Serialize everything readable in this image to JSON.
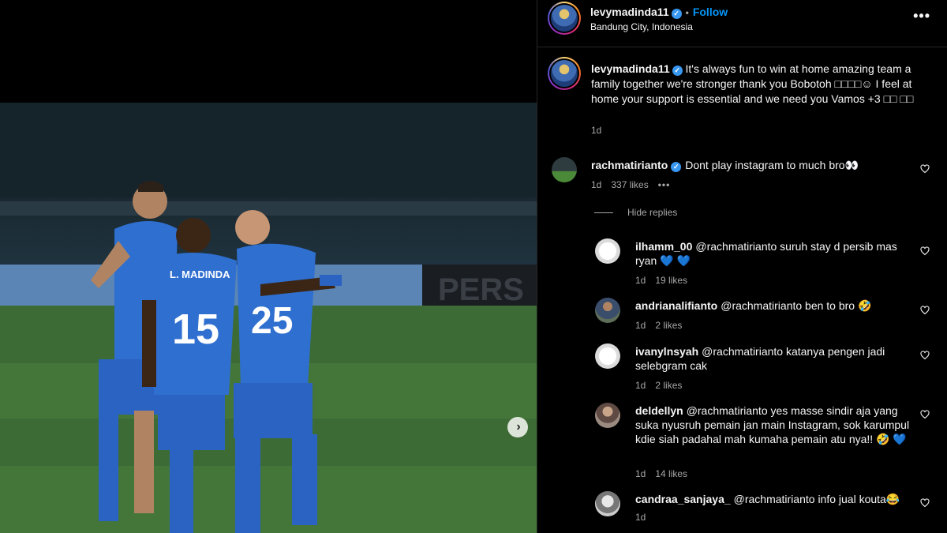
{
  "post": {
    "username": "levymadinda11",
    "verified_mark": "✓",
    "follow_label": "Follow",
    "separator": "•",
    "location": "Bandung City, Indonesia",
    "more_icon": "more-horizontal-icon",
    "more_glyph": "•••"
  },
  "caption": {
    "username": "levymadinda11",
    "text": " It's always fun to win at home amazing team a family together we're stronger thank you Bobotoh □□□□☺ I feel at home your support is essential and we need you Vamos +3 □□ □□",
    "time": "1d"
  },
  "media": {
    "next_icon": "chevron-right-icon",
    "next_glyph": "›"
  },
  "comments": [
    {
      "username": "rachmatirianto",
      "verified": true,
      "text": "Dont play instagram to much bro👀",
      "time": "1d",
      "likes": "337 likes",
      "options": "•••"
    }
  ],
  "hide_replies_label": "Hide replies",
  "replies": [
    {
      "username": "ilhamm_00",
      "text": "@rachmatirianto suruh stay d persib mas ryan 💙 💙",
      "time": "1d",
      "likes": "19 likes"
    },
    {
      "username": "andrianalifianto",
      "text": "@rachmatirianto ben to bro 🤣",
      "time": "1d",
      "likes": "2 likes"
    },
    {
      "username": "ivanylnsyah",
      "text": "@rachmatirianto katanya pengen jadi selebgram cak",
      "time": "1d",
      "likes": "2 likes"
    },
    {
      "username": "deldellyn",
      "text": "@rachmatirianto yes masse sindir aja yang suka nyusruh pemain jan main Instagram, sok karumpul kdie siah padahal mah kumaha pemain atu nya!! 🤣 💙",
      "time": "1d",
      "likes": "14 likes"
    },
    {
      "username": "candraa_sanjaya_",
      "text": "@rachmatirianto info jual kouta😂",
      "time": "1d",
      "likes": ""
    }
  ],
  "colors": {
    "background": "#000000",
    "text": "#f5f5f5",
    "muted": "#a8a8a8",
    "link": "#0095f6",
    "verified": "#3897f0",
    "jersey": "#2f6fd0"
  }
}
